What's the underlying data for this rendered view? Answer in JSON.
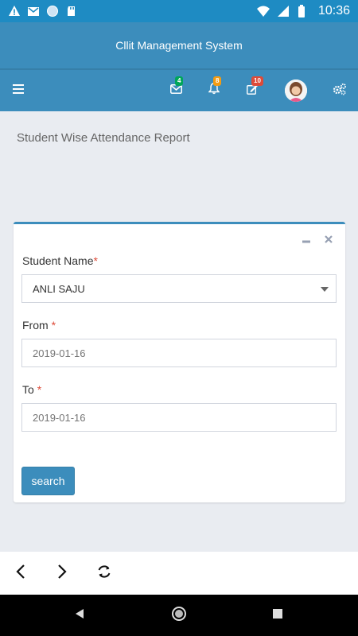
{
  "status_bar": {
    "time": "10:36",
    "icons": [
      "alert-icon",
      "gmail-icon",
      "sync-icon",
      "sd-card-icon",
      "wifi-icon",
      "signal-icon",
      "battery-icon"
    ]
  },
  "header": {
    "title": "Cllit Management System",
    "badges": {
      "messages": "4",
      "notifications": "8",
      "tasks": "10"
    }
  },
  "page": {
    "title": "Student Wise Attendance Report"
  },
  "form": {
    "student_label": "Student Name",
    "student_value": "ANLI SAJU",
    "from_label": "From",
    "from_placeholder": "2019-01-16",
    "to_label": "To",
    "to_placeholder": "2019-01-16",
    "required_mark": "*",
    "search_label": "search"
  },
  "colors": {
    "primary": "#3c8dbc",
    "status_bar": "#1e8bc3",
    "required": "#dd4b39",
    "badge_green": "#00a65a",
    "badge_orange": "#f39c12",
    "badge_red": "#dd4b39"
  }
}
